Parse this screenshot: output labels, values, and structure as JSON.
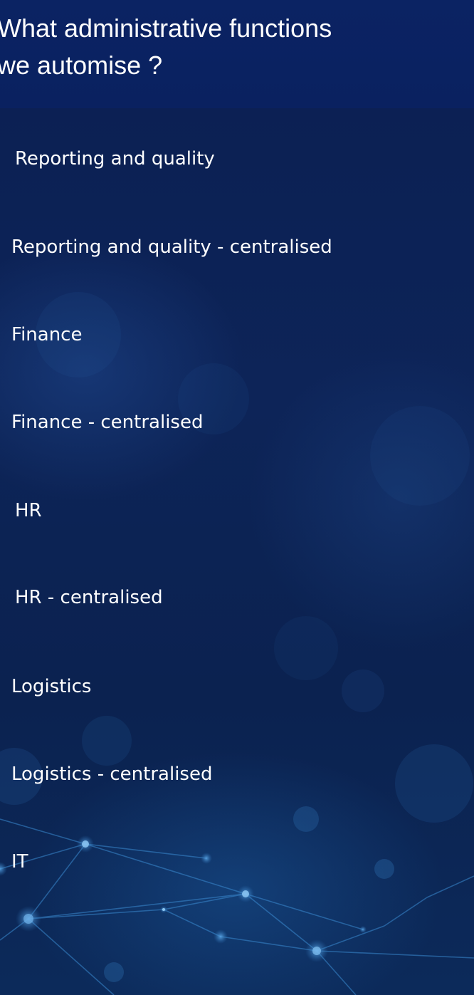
{
  "slide": {
    "title": "What administrative functions\nwe automise ?",
    "items": [
      "Reporting and quality",
      "Reporting and quality - centralised",
      "Finance",
      "Finance - centralised",
      "HR",
      "HR - centralised",
      "Logistics",
      "Logistics - centralised",
      "IT"
    ]
  },
  "colors": {
    "title_bar": "#0a2160",
    "background": "#0c2154",
    "text": "#ffffff",
    "network_lines": "#2e7fc8"
  }
}
